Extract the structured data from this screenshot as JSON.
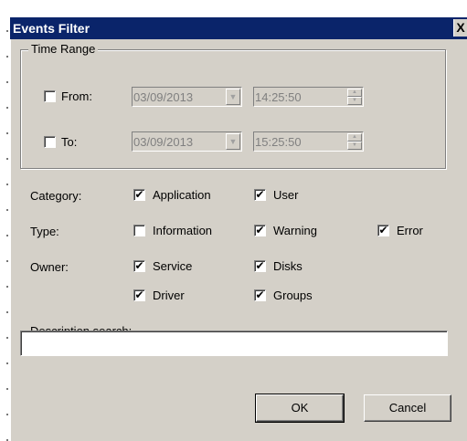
{
  "window": {
    "title": "Events Filter",
    "close_glyph": "X"
  },
  "time_range": {
    "legend": "Time Range",
    "from": {
      "label": "From:",
      "checked": false,
      "date": "03/09/2013",
      "time": "14:25:50"
    },
    "to": {
      "label": "To:",
      "checked": false,
      "date": "03/09/2013",
      "time": "15:25:50"
    }
  },
  "category": {
    "label": "Category:",
    "options": [
      {
        "label": "Application",
        "checked": true
      },
      {
        "label": "User",
        "checked": true
      }
    ]
  },
  "type": {
    "label": "Type:",
    "options": [
      {
        "label": "Information",
        "checked": false
      },
      {
        "label": "Warning",
        "checked": true
      },
      {
        "label": "Error",
        "checked": true
      }
    ]
  },
  "owner": {
    "label": "Owner:",
    "options": [
      {
        "label": "Service",
        "checked": true
      },
      {
        "label": "Disks",
        "checked": true
      },
      {
        "label": "Driver",
        "checked": true
      },
      {
        "label": "Groups",
        "checked": true
      }
    ]
  },
  "description": {
    "label": "Description search:",
    "value": ""
  },
  "buttons": {
    "ok": "OK",
    "cancel": "Cancel"
  }
}
